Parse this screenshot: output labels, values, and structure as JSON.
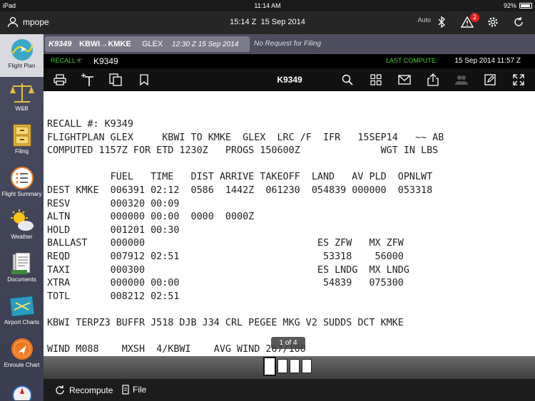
{
  "status_bar": {
    "device": "iPad",
    "clock": "11:14 AM",
    "battery": "92%"
  },
  "app_header": {
    "username": "mpope",
    "utc_time": "15:14 Z",
    "date": "15 Sep 2014",
    "auto_label": "Auto",
    "alert_count": "2"
  },
  "sidebar": {
    "items": [
      {
        "label": "Flight Plan",
        "icon": "flight-plan-icon"
      },
      {
        "label": "W&B",
        "icon": "scale-icon"
      },
      {
        "label": "Filing",
        "icon": "filing-cabinet-icon"
      },
      {
        "label": "Flight Summary",
        "icon": "flight-summary-icon"
      },
      {
        "label": "Weather",
        "icon": "weather-icon"
      },
      {
        "label": "Documents",
        "icon": "documents-icon"
      },
      {
        "label": "Airport Charts",
        "icon": "airport-charts-icon"
      },
      {
        "label": "Enroute Chart",
        "icon": "enroute-chart-icon"
      }
    ]
  },
  "flight_tab": {
    "tail": "K9349",
    "route": "KBWI→KMKE",
    "aircraft": "GLEX",
    "etd": "12:30 Z 15 Sep 2014",
    "note": "No Request for Filing"
  },
  "recall_bar": {
    "recall_label": "RECALL #:",
    "recall_value": "K9349",
    "last_compute_label": "LAST COMPUTE:",
    "last_compute_value": "15 Sep 2014 11:57 Z"
  },
  "toolbar": {
    "title": "K9349"
  },
  "document": {
    "lines": [
      "RECALL #: K9349",
      "FLIGHTPLAN GLEX     KBWI TO KMKE  GLEX  LRC /F  IFR   15SEP14   ~~ AB",
      "COMPUTED 1157Z FOR ETD 1230Z   PROGS 150600Z              WGT IN LBS",
      "",
      "           FUEL   TIME   DIST ARRIVE TAKEOFF  LAND   AV PLD  OPNLWT",
      "DEST KMKE  006391 02:12  0586  1442Z  061230  054839 000000  053318",
      "RESV       000320 00:09",
      "ALTN       000000 00:00  0000  0000Z",
      "HOLD       001201 00:30",
      "BALLAST    000000                              ES ZFW   MX ZFW",
      "REQD       007912 02:51                         53318    56000",
      "TAXI       000300                              ES LNDG  MX LNDG",
      "XTRA       000000 00:00                         54839   075300",
      "TOTL       008212 02:51",
      "",
      "KBWI TERPZ3 BUFFR J518 DJB J34 CRL PEGEE MKG V2 SUDDS DCT KMKE",
      "",
      "WIND M088    MXSH  4/KBWI    AVG WIND 267/100"
    ]
  },
  "pager": {
    "label": "1 of 4",
    "current_page": 1,
    "total_pages": 4
  },
  "bottom_bar": {
    "recompute_label": "Recompute",
    "file_label": "File"
  },
  "colors": {
    "accent_green": "#4cd137",
    "sidebar_bg": "#44475a",
    "badge_red": "#e02020"
  }
}
